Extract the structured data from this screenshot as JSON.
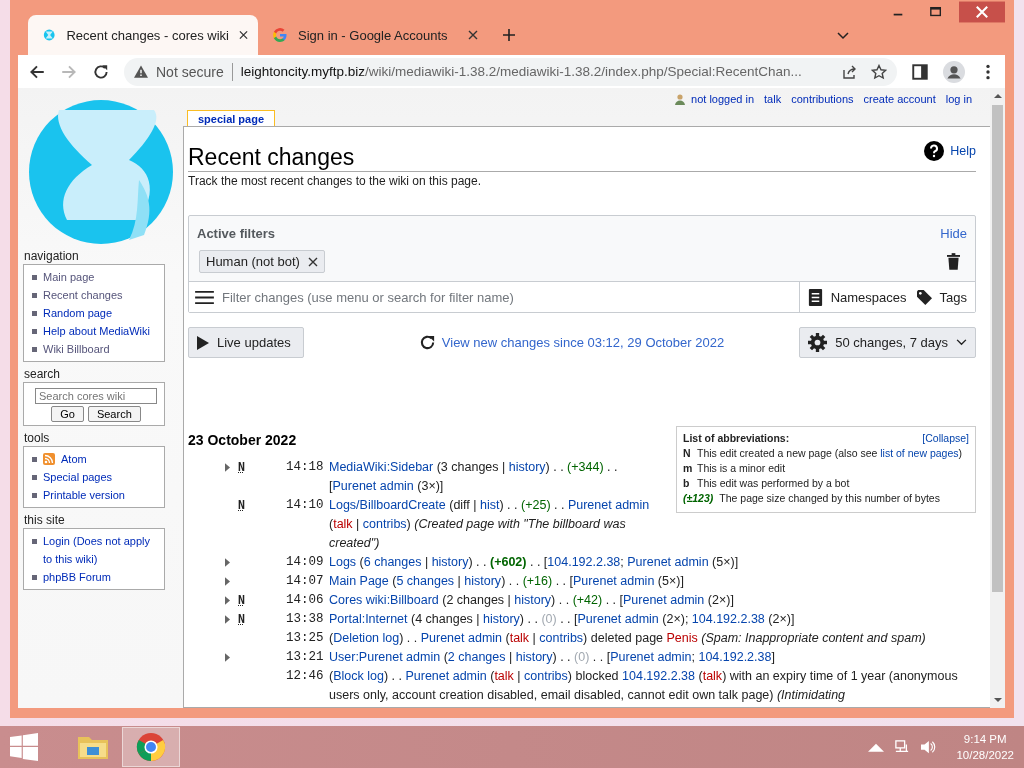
{
  "browser": {
    "tabs": [
      {
        "title": "Recent changes - cores wiki",
        "selected": true
      },
      {
        "title": "Sign in - Google Accounts",
        "selected": false
      }
    ],
    "forward_disabled": true,
    "security": "Not secure",
    "url_host": "leightoncity.myftp.biz",
    "url_path": "/wiki/mediawiki-1.38.2/mediawiki-1.38.2/index.php/Special:RecentChan..."
  },
  "personal_links": [
    {
      "label": "not logged in",
      "kind": "status"
    },
    {
      "label": "talk",
      "kind": "link"
    },
    {
      "label": "contributions",
      "kind": "link"
    },
    {
      "label": "create account",
      "kind": "link"
    },
    {
      "label": "log in",
      "kind": "link"
    }
  ],
  "sidebar": [
    {
      "title": "navigation",
      "kind": "links",
      "items": [
        {
          "label": "Main page",
          "visited": true
        },
        {
          "label": "Recent changes",
          "visited": true
        },
        {
          "label": "Random page",
          "visited": false
        },
        {
          "label": "Help about MediaWiki",
          "visited": false
        },
        {
          "label": "Wiki Billboard",
          "visited": true
        }
      ]
    },
    {
      "title": "search",
      "kind": "search",
      "placeholder": "Search cores wiki",
      "buttons": [
        "Go",
        "Search"
      ]
    },
    {
      "title": "tools",
      "kind": "links",
      "items": [
        {
          "label": "Atom",
          "visited": false,
          "kind": "feed"
        },
        {
          "label": "Special pages",
          "visited": false
        },
        {
          "label": "Printable version",
          "visited": false
        }
      ]
    },
    {
      "title": "this site",
      "kind": "links",
      "items": [
        {
          "label": "Login (Does not apply to this wiki)",
          "visited": false
        },
        {
          "label": "phpBB Forum",
          "visited": false
        }
      ]
    }
  ],
  "page_tab": "special page",
  "title": "Recent changes",
  "help": "Help",
  "subtitle": "Track the most recent changes to the wiki on this page.",
  "filters": {
    "title": "Active filters",
    "hide": "Hide",
    "tags": [
      "Human (not bot)"
    ],
    "placeholder": "Filter changes (use menu or search for filter name)",
    "namespaces": "Namespaces",
    "tags_button": "Tags"
  },
  "live_updates": "Live updates",
  "view_new": "View new changes since 03:12, 29 October 2022",
  "options": "50 changes, 7 days",
  "abbreviations": {
    "title": "List of abbreviations:",
    "collapse": "[Collapse]",
    "items": [
      {
        "key": "N",
        "kind": "key",
        "segments": [
          {
            "kind": "text",
            "text": "This edit created a new page (also see "
          },
          {
            "kind": "link",
            "text": "list of new pages"
          },
          {
            "kind": "text",
            "text": ")"
          }
        ]
      },
      {
        "key": "m",
        "kind": "key",
        "segments": [
          {
            "kind": "text",
            "text": "This is a minor edit"
          }
        ]
      },
      {
        "key": "b",
        "kind": "key",
        "segments": [
          {
            "kind": "text",
            "text": "This edit was performed by a bot"
          }
        ]
      },
      {
        "key": "(±123)",
        "kind": "size",
        "segments": [
          {
            "kind": "text",
            "text": "The page size changed by this number of bytes"
          }
        ]
      }
    ]
  },
  "date": "23 October 2022",
  "changes": [
    {
      "expandable": true,
      "flag": "N",
      "time": "14:18",
      "segments": [
        {
          "kind": "link",
          "text": "MediaWiki:Sidebar"
        },
        {
          "kind": "text",
          "text": " (3 changes | "
        },
        {
          "kind": "link",
          "text": "history"
        },
        {
          "kind": "text",
          "text": ") . . "
        },
        {
          "kind": "plus",
          "text": "(+344)"
        },
        {
          "kind": "text",
          "text": " . . ["
        },
        {
          "kind": "link",
          "text": "Purenet admin"
        },
        {
          "kind": "text",
          "text": " (3×)]"
        }
      ]
    },
    {
      "expandable": false,
      "flag": "N",
      "time": "14:10",
      "segments": [
        {
          "kind": "link",
          "text": "Logs/BillboardCreate"
        },
        {
          "kind": "text",
          "text": " (diff | "
        },
        {
          "kind": "link",
          "text": "hist"
        },
        {
          "kind": "text",
          "text": ") . . "
        },
        {
          "kind": "plus",
          "text": "(+25)"
        },
        {
          "kind": "text",
          "text": " . . "
        },
        {
          "kind": "link",
          "text": "Purenet admin"
        },
        {
          "kind": "text",
          "text": " ("
        },
        {
          "kind": "red",
          "text": "talk"
        },
        {
          "kind": "text",
          "text": " | "
        },
        {
          "kind": "link",
          "text": "contribs"
        },
        {
          "kind": "text",
          "text": ") "
        },
        {
          "kind": "comment",
          "text": "(Created page with \"The billboard was created\")"
        }
      ]
    },
    {
      "expandable": true,
      "time": "14:09",
      "segments": [
        {
          "kind": "link",
          "text": "Logs"
        },
        {
          "kind": "text",
          "text": " ("
        },
        {
          "kind": "link",
          "text": "6 changes"
        },
        {
          "kind": "text",
          "text": " | "
        },
        {
          "kind": "link",
          "text": "history"
        },
        {
          "kind": "text",
          "text": ") . . "
        },
        {
          "kind": "bigplus",
          "text": "(+602)"
        },
        {
          "kind": "text",
          "text": " . . ["
        },
        {
          "kind": "link",
          "text": "104.192.2.38"
        },
        {
          "kind": "text",
          "text": "; "
        },
        {
          "kind": "link",
          "text": "Purenet admin"
        },
        {
          "kind": "text",
          "text": " (5×)]"
        }
      ]
    },
    {
      "expandable": true,
      "time": "14:07",
      "segments": [
        {
          "kind": "link",
          "text": "Main Page"
        },
        {
          "kind": "text",
          "text": " ("
        },
        {
          "kind": "link",
          "text": "5 changes"
        },
        {
          "kind": "text",
          "text": " | "
        },
        {
          "kind": "link",
          "text": "history"
        },
        {
          "kind": "text",
          "text": ") . . "
        },
        {
          "kind": "plus",
          "text": "(+16)"
        },
        {
          "kind": "text",
          "text": " . . ["
        },
        {
          "kind": "link",
          "text": "Purenet admin"
        },
        {
          "kind": "text",
          "text": " (5×)]"
        }
      ]
    },
    {
      "expandable": true,
      "flag": "N",
      "time": "14:06",
      "segments": [
        {
          "kind": "link",
          "text": "Cores wiki:Billboard"
        },
        {
          "kind": "text",
          "text": " (2 changes | "
        },
        {
          "kind": "link",
          "text": "history"
        },
        {
          "kind": "text",
          "text": ") . . "
        },
        {
          "kind": "plus",
          "text": "(+42)"
        },
        {
          "kind": "text",
          "text": " . . ["
        },
        {
          "kind": "link",
          "text": "Purenet admin"
        },
        {
          "kind": "text",
          "text": " (2×)]"
        }
      ]
    },
    {
      "expandable": true,
      "flag": "N",
      "time": "13:38",
      "segments": [
        {
          "kind": "link",
          "text": "Portal:Internet"
        },
        {
          "kind": "text",
          "text": " (4 changes | "
        },
        {
          "kind": "link",
          "text": "history"
        },
        {
          "kind": "text",
          "text": ") . . "
        },
        {
          "kind": "zero",
          "text": "(0)"
        },
        {
          "kind": "text",
          "text": " . . ["
        },
        {
          "kind": "link",
          "text": "Purenet admin"
        },
        {
          "kind": "text",
          "text": " (2×); "
        },
        {
          "kind": "link",
          "text": "104.192.2.38"
        },
        {
          "kind": "text",
          "text": " (2×)]"
        }
      ]
    },
    {
      "expandable": false,
      "time": "13:25",
      "segments": [
        {
          "kind": "text",
          "text": "("
        },
        {
          "kind": "link",
          "text": "Deletion log"
        },
        {
          "kind": "text",
          "text": ") . . "
        },
        {
          "kind": "link",
          "text": "Purenet admin"
        },
        {
          "kind": "text",
          "text": " ("
        },
        {
          "kind": "red",
          "text": "talk"
        },
        {
          "kind": "text",
          "text": " | "
        },
        {
          "kind": "link",
          "text": "contribs"
        },
        {
          "kind": "text",
          "text": ") deleted page "
        },
        {
          "kind": "red",
          "text": "Penis"
        },
        {
          "kind": "comment",
          "text": " (Spam: Inappropriate content and spam)"
        }
      ]
    },
    {
      "expandable": true,
      "time": "13:21",
      "segments": [
        {
          "kind": "link",
          "text": "User:Purenet admin"
        },
        {
          "kind": "text",
          "text": " ("
        },
        {
          "kind": "link",
          "text": "2 changes"
        },
        {
          "kind": "text",
          "text": " | "
        },
        {
          "kind": "link",
          "text": "history"
        },
        {
          "kind": "text",
          "text": ") . . "
        },
        {
          "kind": "zero",
          "text": "(0)"
        },
        {
          "kind": "text",
          "text": " . . ["
        },
        {
          "kind": "link",
          "text": "Purenet admin"
        },
        {
          "kind": "text",
          "text": "; "
        },
        {
          "kind": "link",
          "text": "104.192.2.38"
        },
        {
          "kind": "text",
          "text": "]"
        }
      ]
    },
    {
      "expandable": false,
      "time": "12:46",
      "segments": [
        {
          "kind": "text",
          "text": "("
        },
        {
          "kind": "link",
          "text": "Block log"
        },
        {
          "kind": "text",
          "text": ") . . "
        },
        {
          "kind": "link",
          "text": "Purenet admin"
        },
        {
          "kind": "text",
          "text": " ("
        },
        {
          "kind": "red",
          "text": "talk"
        },
        {
          "kind": "text",
          "text": " | "
        },
        {
          "kind": "link",
          "text": "contribs"
        },
        {
          "kind": "text",
          "text": ") blocked "
        },
        {
          "kind": "link",
          "text": "104.192.2.38"
        },
        {
          "kind": "text",
          "text": " ("
        },
        {
          "kind": "red",
          "text": "talk"
        },
        {
          "kind": "text",
          "text": ") with an expiry time of 1 year (anonymous users only, account creation disabled, email disabled, cannot edit own talk page) "
        },
        {
          "kind": "comment",
          "text": "(Intimidating"
        }
      ]
    }
  ],
  "taskbar": {
    "apps": [
      {
        "kind": "folder",
        "selected": false
      },
      {
        "kind": "browser",
        "selected": true
      }
    ],
    "time": "9:14 PM",
    "date": "10/28/2022"
  }
}
